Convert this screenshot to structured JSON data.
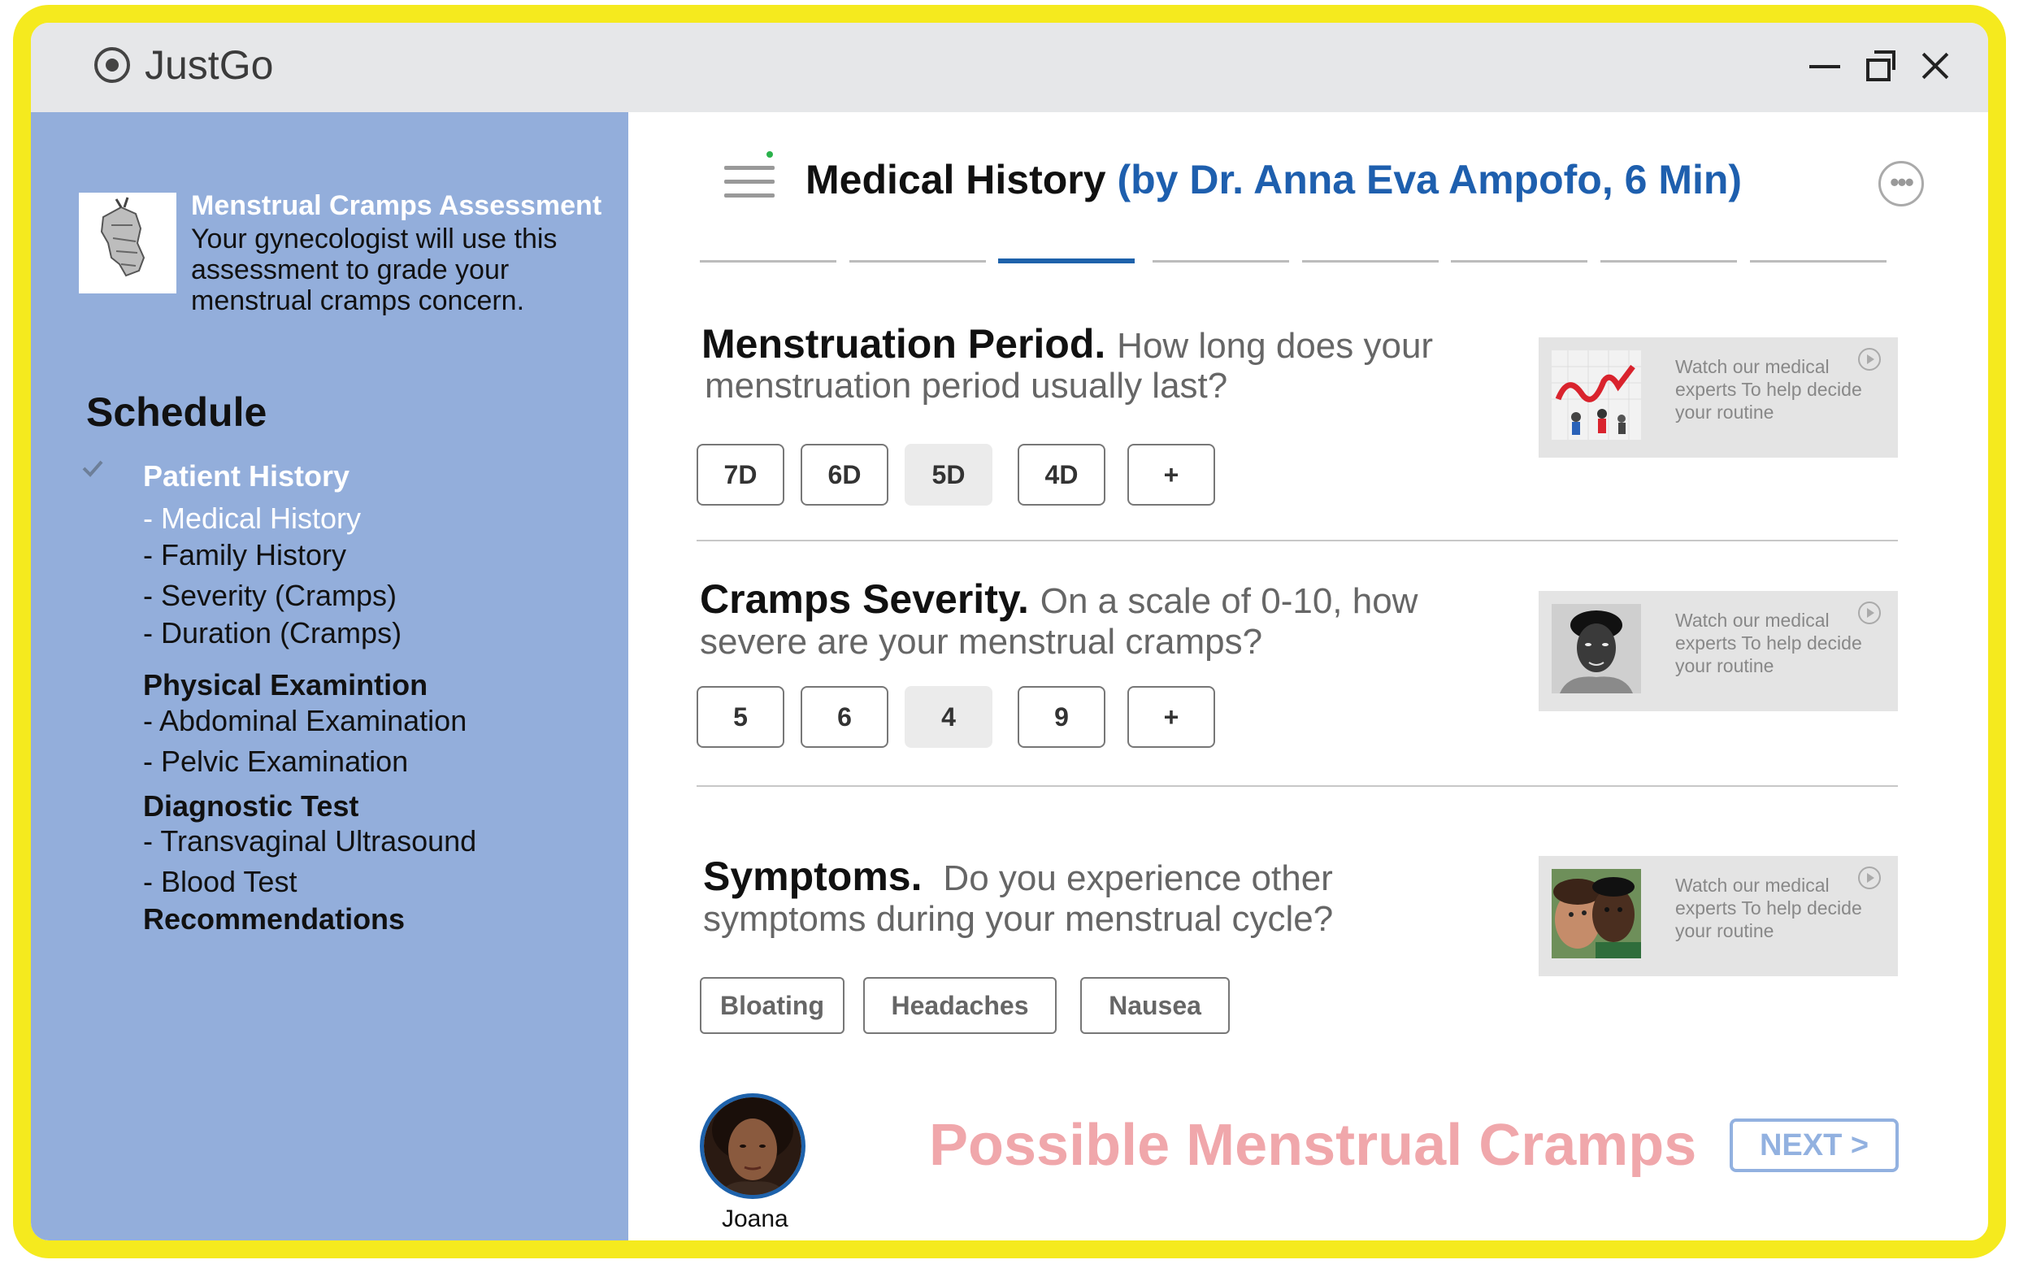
{
  "app": {
    "title": "JustGo"
  },
  "course": {
    "title": "Menstrual Cramps Assessment",
    "description": "Your gynecologist will use this assessment to grade your menstrual cramps concern."
  },
  "schedule": {
    "heading": "Schedule",
    "items": [
      {
        "label": "Patient History",
        "type": "section",
        "completed": true,
        "active": true
      },
      {
        "label": "- Medical History",
        "type": "sub",
        "active": true
      },
      {
        "label": "- Family History",
        "type": "sub"
      },
      {
        "label": "- Severity (Cramps)",
        "type": "sub"
      },
      {
        "label": "- Duration (Cramps)",
        "type": "sub"
      },
      {
        "label": "Physical Examintion",
        "type": "section"
      },
      {
        "label": "- Abdominal Examination",
        "type": "sub"
      },
      {
        "label": "- Pelvic Examination",
        "type": "sub"
      },
      {
        "label": "Diagnostic Test",
        "type": "section"
      },
      {
        "label": "- Transvaginal Ultrasound",
        "type": "sub"
      },
      {
        "label": "- Blood Test",
        "type": "sub"
      },
      {
        "label": "Recommendations",
        "type": "section"
      }
    ]
  },
  "header": {
    "title": "Medical History",
    "subtitle": "(by Dr. Anna Eva Ampofo, 6 Min)",
    "progress": {
      "steps": 8,
      "current": 3
    }
  },
  "questions": [
    {
      "title": "Menstruation Period.",
      "prompt_line1": "How long does your",
      "prompt_line2": "menstruation period usually last?",
      "options": [
        "7D",
        "6D",
        "5D",
        "4D",
        "+"
      ],
      "selected": "5D",
      "video_text": "Watch our medical experts To help decide your routine"
    },
    {
      "title": "Cramps Severity.",
      "prompt_line1": "On a scale of 0-10, how",
      "prompt_line2": "severe are your menstrual cramps?",
      "options": [
        "5",
        "6",
        "4",
        "9",
        "+"
      ],
      "selected": "4",
      "video_text": "Watch our medical experts To help decide your routine"
    },
    {
      "title": "Symptoms.",
      "prompt_line1": "Do you experience other",
      "prompt_line2": "symptoms during your menstrual cycle?",
      "options": [
        "Bloating",
        "Headaches",
        "Nausea"
      ],
      "video_text": "Watch our medical experts To help decide your routine"
    }
  ],
  "footer": {
    "patient_name": "Joana",
    "result": "Possible Menstrual Cramps",
    "next_label": "NEXT >"
  },
  "colors": {
    "frame": "#f5ea1e",
    "sidebar": "#93aedb",
    "accent": "#1e5fae",
    "result": "#f0a7ab",
    "next": "#92b1e0"
  }
}
